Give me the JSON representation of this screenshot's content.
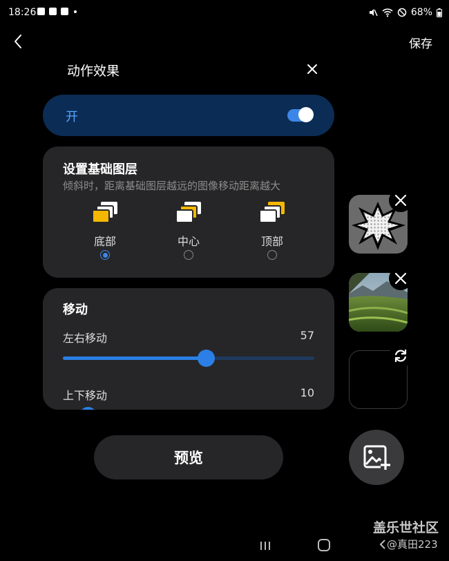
{
  "status_bar": {
    "time": "18:26",
    "battery": "68%"
  },
  "header": {
    "save_label": "保存"
  },
  "panel": {
    "title": "动作效果"
  },
  "toggle": {
    "label": "开",
    "on": true
  },
  "layer": {
    "title": "设置基础图层",
    "description": "倾斜时，距离基础图层越远的图像移动距离越大",
    "options": [
      {
        "label": "底部",
        "selected": true
      },
      {
        "label": "中心",
        "selected": false
      },
      {
        "label": "顶部",
        "selected": false
      }
    ]
  },
  "move": {
    "title": "移动",
    "horizontal": {
      "label": "左右移动",
      "value": "57",
      "fraction": 0.57
    },
    "vertical": {
      "label": "上下移动",
      "value": "10",
      "fraction": 0.1
    }
  },
  "preview_label": "预览",
  "watermark": {
    "line1": "盖乐世社区",
    "line2": "@真田223"
  },
  "colors": {
    "accent": "#3d86e8",
    "highlight_layer": "#f5b800",
    "card": "#262628",
    "toggle_bg": "#0b2c55"
  }
}
